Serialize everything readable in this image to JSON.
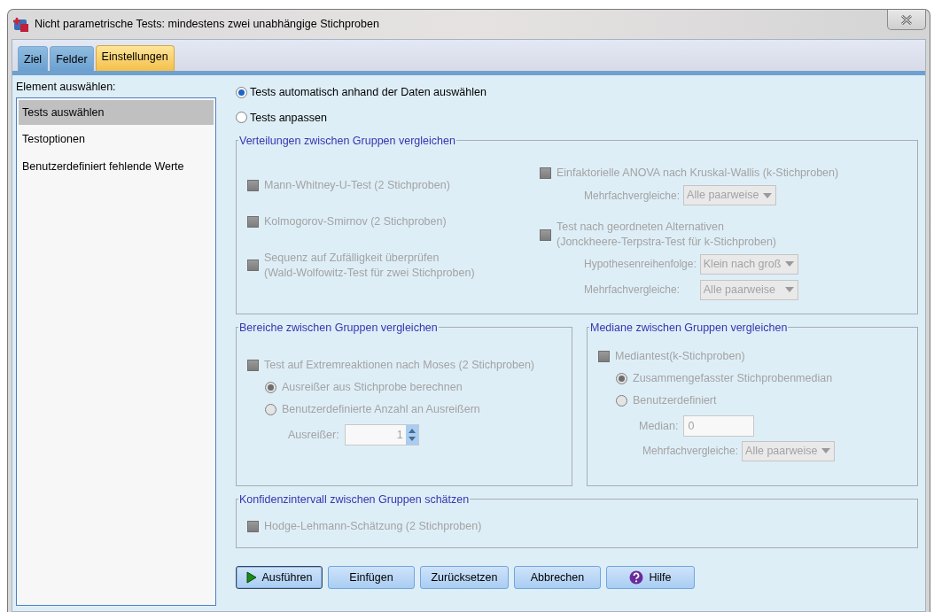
{
  "window": {
    "title": "Nicht parametrische Tests: mindestens zwei unabhängige Stichproben"
  },
  "tabs": [
    {
      "label": "Ziel",
      "selected": false
    },
    {
      "label": "Felder",
      "selected": false
    },
    {
      "label": "Einstellungen",
      "selected": true
    }
  ],
  "sidebar": {
    "label": "Element auswählen:",
    "items": [
      {
        "label": "Tests auswählen",
        "selected": true
      },
      {
        "label": "Testoptionen",
        "selected": false
      },
      {
        "label": "Benutzerdefiniert fehlende Werte",
        "selected": false
      }
    ]
  },
  "mode_options": [
    {
      "label": "Tests automatisch anhand der Daten auswählen",
      "selected": true
    },
    {
      "label": "Tests anpassen",
      "selected": false
    }
  ],
  "distribution_group": {
    "title": "Verteilungen zwischen Gruppen vergleichen",
    "left": [
      {
        "kind": "checkbox",
        "label": "Mann-Whitney-U-Test (2 Stichproben)",
        "checked": false,
        "disabled": true
      },
      {
        "kind": "checkbox",
        "label": "Kolmogorov-Smirnov (2 Stichproben)",
        "checked": false,
        "disabled": true
      },
      {
        "kind": "checkbox",
        "label": "Sequenz auf Zufälligkeit überprüfen\n(Wald-Wolfowitz-Test für zwei Stichproben)",
        "checked": false,
        "disabled": true
      }
    ],
    "right": [
      {
        "kind": "checkbox",
        "label": "Einfaktorielle ANOVA nach Kruskal-Wallis (k-Stichproben)",
        "checked": false,
        "disabled": true,
        "children": [
          {
            "kind": "dropdown",
            "label": "Mehrfachvergleiche:",
            "value": "Alle paarweise",
            "disabled": true
          }
        ]
      },
      {
        "kind": "checkbox",
        "label": "Test nach geordneten Alternativen\n(Jonckheere-Terpstra-Test für k-Stichproben)",
        "checked": false,
        "disabled": true,
        "children": [
          {
            "kind": "dropdown",
            "label": "Hypothesenreihenfolge:",
            "value": "Klein nach groß",
            "disabled": true
          },
          {
            "kind": "dropdown",
            "label": "Mehrfachvergleiche:",
            "value": "Alle paarweise",
            "disabled": true
          }
        ]
      }
    ]
  },
  "range_group": {
    "title": "Bereiche zwischen Gruppen vergleichen",
    "items": [
      {
        "kind": "checkbox",
        "label": "Test auf Extremreaktionen nach Moses (2 Stichproben)",
        "checked": false,
        "disabled": true,
        "children": [
          {
            "kind": "radio",
            "label": "Ausreißer aus Stichprobe berechnen",
            "selected": true,
            "disabled": true
          },
          {
            "kind": "radio",
            "label": "Benutzerdefinierte Anzahl an Ausreißern",
            "selected": false,
            "disabled": true,
            "children": [
              {
                "kind": "spinner",
                "label": "Ausreißer:",
                "value": "1",
                "disabled": true
              }
            ]
          }
        ]
      }
    ]
  },
  "median_group": {
    "title": "Mediane zwischen Gruppen vergleichen",
    "items": [
      {
        "kind": "checkbox",
        "label": "Mediantest(k-Stichproben)",
        "checked": false,
        "disabled": true,
        "children": [
          {
            "kind": "radio",
            "label": "Zusammengefasster Stichprobenmedian",
            "selected": true,
            "disabled": true
          },
          {
            "kind": "radio",
            "label": "Benutzerdefiniert",
            "selected": false,
            "disabled": true,
            "children": [
              {
                "kind": "field",
                "label": "Median:",
                "value": "0",
                "disabled": true
              }
            ]
          },
          {
            "kind": "dropdown",
            "label": "Mehrfachvergleiche:",
            "value": "Alle paarweise",
            "disabled": true
          }
        ]
      }
    ]
  },
  "confidence_group": {
    "title": "Konfidenzintervall zwischen Gruppen schätzen",
    "items": [
      {
        "kind": "checkbox",
        "label": "Hodge-Lehmann-Schätzung (2 Stichproben)",
        "checked": false,
        "disabled": true
      }
    ]
  },
  "buttons": [
    {
      "label": "Ausführen",
      "kind": "run",
      "default": true
    },
    {
      "label": "Einfügen",
      "kind": "plain",
      "default": false
    },
    {
      "label": "Zurücksetzen",
      "kind": "plain",
      "default": false
    },
    {
      "label": "Abbrechen",
      "kind": "plain",
      "default": false
    },
    {
      "label": "Hilfe",
      "kind": "help",
      "default": false
    }
  ]
}
